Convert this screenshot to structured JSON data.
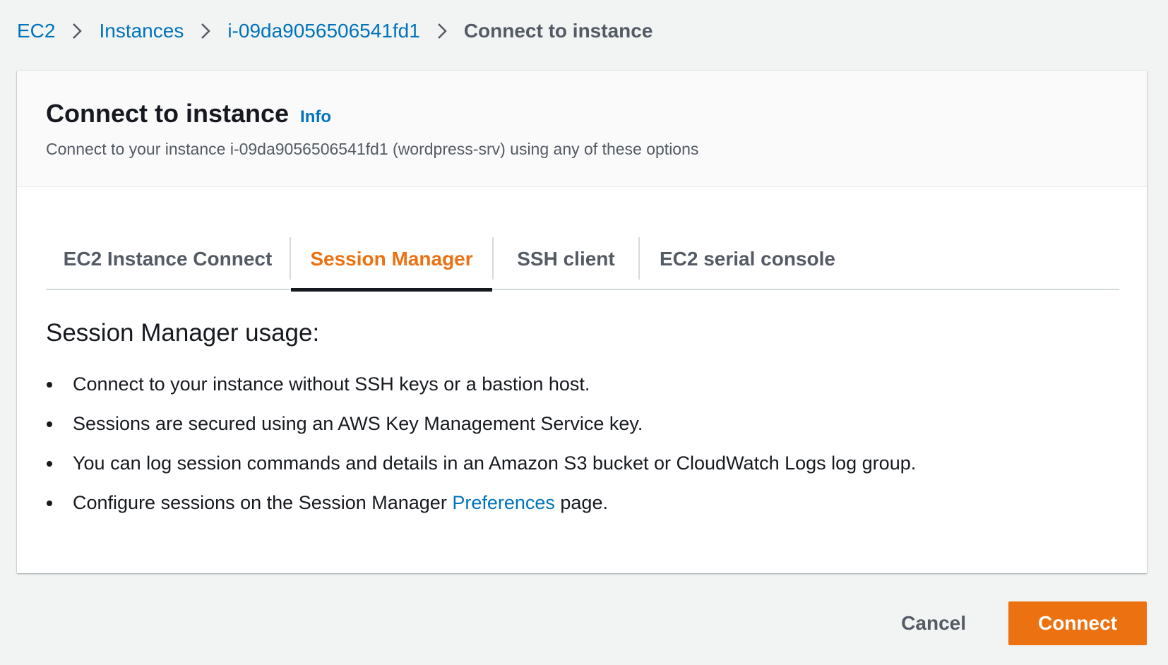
{
  "breadcrumb": {
    "items": [
      "EC2",
      "Instances",
      "i-09da9056506541fd1"
    ],
    "current": "Connect to instance"
  },
  "header": {
    "title": "Connect to instance",
    "info_label": "Info",
    "description": "Connect to your instance i-09da9056506541fd1 (wordpress-srv) using any of these options"
  },
  "tabs": [
    {
      "label": "EC2 Instance Connect",
      "active": false
    },
    {
      "label": "Session Manager",
      "active": true
    },
    {
      "label": "SSH client",
      "active": false
    },
    {
      "label": "EC2 serial console",
      "active": false
    }
  ],
  "session_manager": {
    "heading": "Session Manager usage:",
    "bullets": [
      "Connect to your instance without SSH keys or a bastion host.",
      "Sessions are secured using an AWS Key Management Service key.",
      "You can log session commands and details in an Amazon S3 bucket or CloudWatch Logs log group."
    ],
    "last_bullet": {
      "prefix": "Configure sessions on the Session Manager ",
      "link": "Preferences",
      "suffix": " page."
    }
  },
  "actions": {
    "cancel_label": "Cancel",
    "connect_label": "Connect"
  },
  "colors": {
    "link": "#0073bb",
    "accent": "#ec7211",
    "text": "#16191f",
    "muted": "#545b64"
  },
  "icons": {
    "breadcrumb_separator": "chevron-right-icon"
  }
}
